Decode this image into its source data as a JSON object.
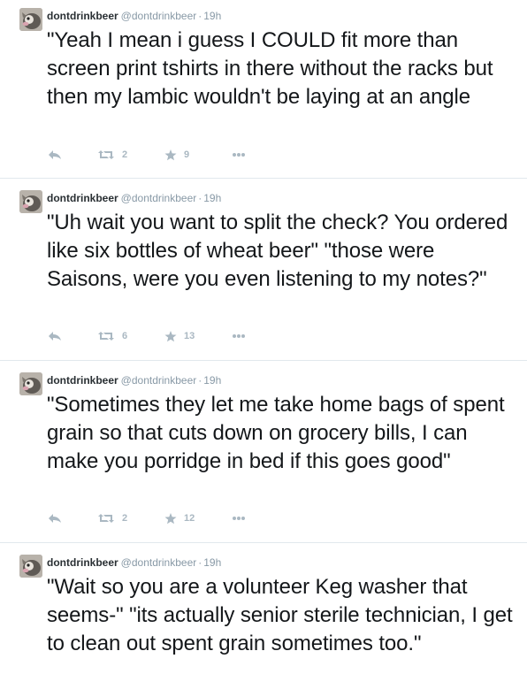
{
  "tweets": [
    {
      "fullname": "dontdrinkbeer",
      "username": "@dontdrinkbeer",
      "separator": "·",
      "time": "19h",
      "text": "\"Yeah I mean i guess I COULD fit more than screen print tshirts in there without the racks but then my lambic wouldn't be laying at an angle",
      "retweets": "2",
      "favorites": "9"
    },
    {
      "fullname": "dontdrinkbeer",
      "username": "@dontdrinkbeer",
      "separator": "·",
      "time": "19h",
      "text": "\"Uh wait you want to split the check? You ordered like six bottles of wheat beer\" \"those were Saisons, were you even listening to my notes?\"",
      "retweets": "6",
      "favorites": "13"
    },
    {
      "fullname": "dontdrinkbeer",
      "username": "@dontdrinkbeer",
      "separator": "·",
      "time": "19h",
      "text": "\"Sometimes they let me take home bags of spent grain so that cuts down on grocery bills, I can make you porridge in bed if this goes good\"",
      "retweets": "2",
      "favorites": "12"
    },
    {
      "fullname": "dontdrinkbeer",
      "username": "@dontdrinkbeer",
      "separator": "·",
      "time": "19h",
      "text": "\"Wait so you are a volunteer Keg washer that seems-\" \"its actually senior sterile technician, I get to clean out spent grain sometimes too.\""
    }
  ],
  "icons": {
    "reply": "reply-icon",
    "retweet": "retweet-icon",
    "favorite": "star-icon",
    "more": "more-icon"
  },
  "colors": {
    "text": "#14171a",
    "muted": "#8899a6",
    "icon": "#aab8c2",
    "divider": "#e1e8ed"
  }
}
